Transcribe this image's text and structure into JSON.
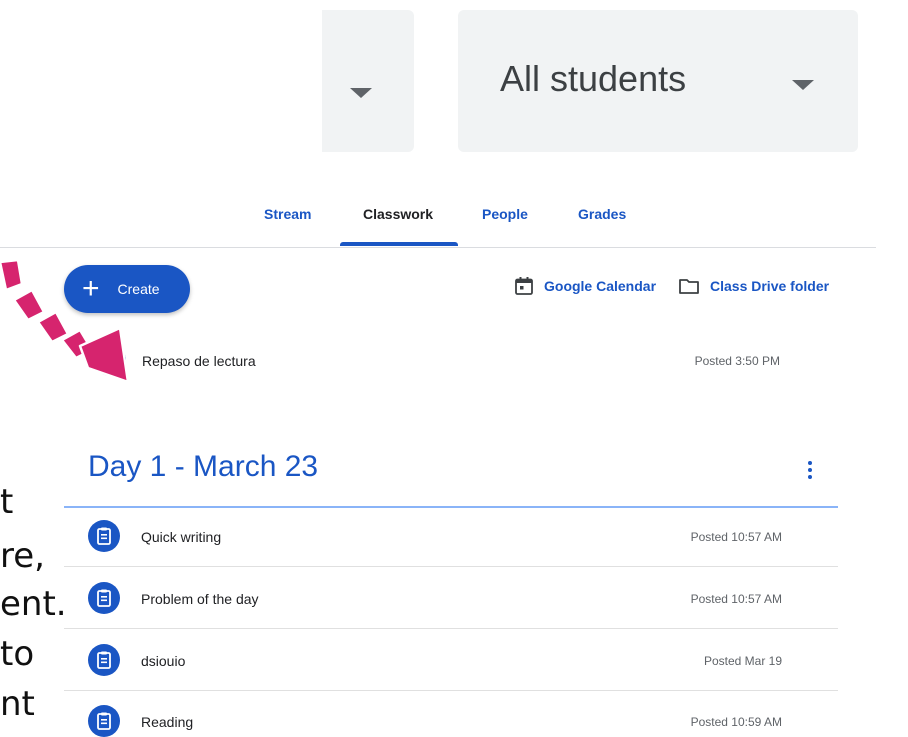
{
  "filters": {
    "left_dropdown_icon": "caret-down",
    "right_dropdown_label": "All students"
  },
  "tabs": [
    {
      "label": "Stream",
      "active": false
    },
    {
      "label": "Classwork",
      "active": true
    },
    {
      "label": "People",
      "active": false
    },
    {
      "label": "Grades",
      "active": false
    }
  ],
  "toolbar": {
    "create_label": "Create",
    "calendar_label": "Google Calendar",
    "drive_label": "Class Drive folder"
  },
  "top_item": {
    "title": "Repaso de lectura",
    "posted": "Posted 3:50 PM"
  },
  "topic": {
    "title": "Day 1 - March 23",
    "items": [
      {
        "title": "Quick writing",
        "posted": "Posted 10:57 AM"
      },
      {
        "title": "Problem of the day",
        "posted": "Posted 10:57 AM"
      },
      {
        "title": "dsiouio",
        "posted": "Posted Mar 19"
      },
      {
        "title": "Reading",
        "posted": "Posted 10:59 AM"
      }
    ]
  },
  "overlay_text": [
    "t",
    "re,",
    "ent.",
    "to",
    "nt"
  ],
  "colors": {
    "accent": "#1a56c4",
    "annotation_arrow": "#d6246e"
  }
}
